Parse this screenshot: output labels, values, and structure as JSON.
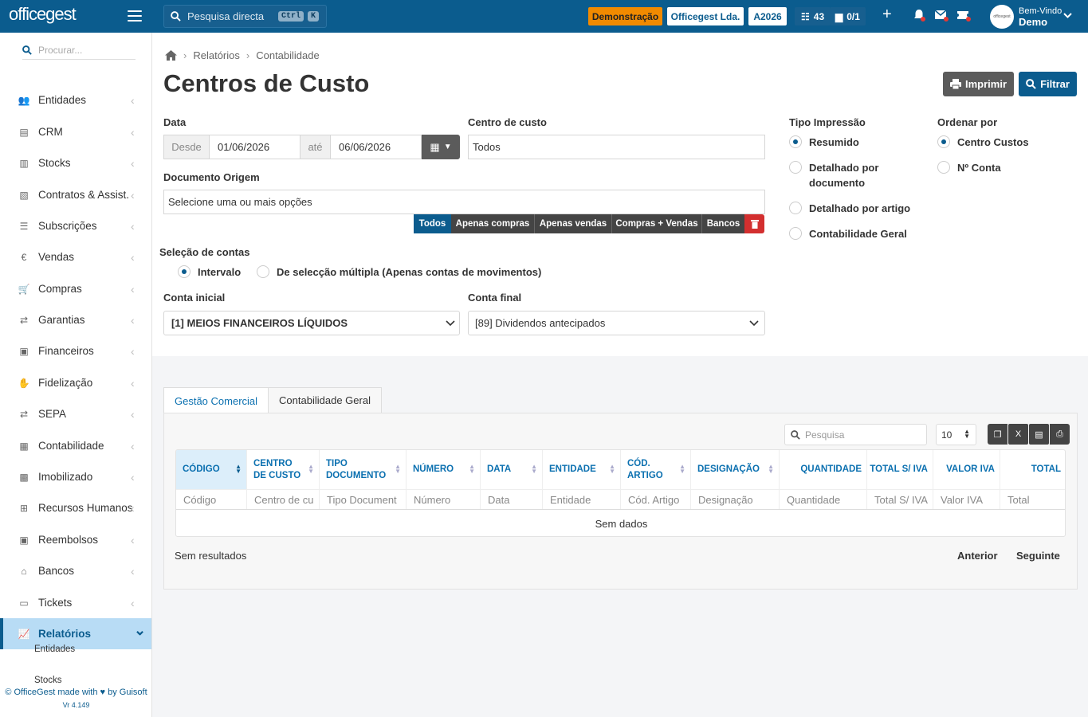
{
  "topbar": {
    "logo": "officegest",
    "search_placeholder": "Pesquisa directa",
    "kbd1": "Ctrl",
    "kbd2": "K",
    "badge_demo": "Demonstração",
    "badge_company": "Officegest Lda.",
    "badge_year": "A2026",
    "tasks_count": "43",
    "docs_count": "0/1",
    "welcome": "Bem-Vindo",
    "user": "Demo",
    "colors": {
      "bar": "#0b5c8e",
      "demo": "#f18a00"
    }
  },
  "sidebar": {
    "search_placeholder": "Procurar...",
    "items": [
      {
        "label": "Entidades",
        "icon": "users-icon"
      },
      {
        "label": "CRM",
        "icon": "book-icon"
      },
      {
        "label": "Stocks",
        "icon": "warehouse-icon"
      },
      {
        "label": "Contratos & Assist.",
        "icon": "file-contract-icon"
      },
      {
        "label": "Subscrições",
        "icon": "list-icon"
      },
      {
        "label": "Vendas",
        "icon": "euro-icon"
      },
      {
        "label": "Compras",
        "icon": "cart-icon"
      },
      {
        "label": "Garantias",
        "icon": "exchange-icon"
      },
      {
        "label": "Financeiros",
        "icon": "money-icon"
      },
      {
        "label": "Fidelização",
        "icon": "hand-coin-icon"
      },
      {
        "label": "SEPA",
        "icon": "exchange-icon"
      },
      {
        "label": "Contabilidade",
        "icon": "calculator-icon"
      },
      {
        "label": "Imobilizado",
        "icon": "box-icon"
      },
      {
        "label": "Recursos Humanos",
        "icon": "sitemap-icon"
      },
      {
        "label": "Reembolsos",
        "icon": "money-icon"
      },
      {
        "label": "Bancos",
        "icon": "bank-icon"
      },
      {
        "label": "Tickets",
        "icon": "ticket-icon"
      },
      {
        "label": "Relatórios",
        "icon": "chart-icon"
      }
    ],
    "sub_items": [
      "Entidades",
      "Stocks"
    ],
    "footer_line1": "© OfficeGest made with",
    "footer_line1b": "by Guisoft",
    "version": "Vr 4.149"
  },
  "page": {
    "breadcrumb": [
      "Relatórios",
      "Contabilidade"
    ],
    "title": "Centros de Custo",
    "print_btn": "Imprimir",
    "filter_btn": "Filtrar"
  },
  "form": {
    "data_label": "Data",
    "desde": "Desde",
    "date_from": "01/06/2026",
    "ate": "até",
    "date_to": "06/06/2026",
    "centro_label": "Centro de custo",
    "centro_value": "Todos",
    "doc_label": "Documento Origem",
    "doc_placeholder": "Selecione uma ou mais opções",
    "doc_buttons": [
      "Todos",
      "Apenas compras",
      "Apenas vendas",
      "Compras + Vendas",
      "Bancos"
    ],
    "tipo_label": "Tipo Impressão",
    "tipo_options": [
      "Resumido",
      "Detalhado por documento",
      "Detalhado por artigo",
      "Contabilidade Geral"
    ],
    "ordenar_label": "Ordenar por",
    "ordenar_options": [
      "Centro Custos",
      "Nº Conta"
    ],
    "selecao_label": "Seleção de contas",
    "selecao_options": [
      "Intervalo",
      "De selecção múltipla (Apenas contas de movimentos)"
    ],
    "conta_inicial_label": "Conta inicial",
    "conta_inicial_value": "[1] MEIOS FINANCEIROS LÍQUIDOS",
    "conta_final_label": "Conta final",
    "conta_final_value": "[89] Dividendos antecipados"
  },
  "results": {
    "tabs": [
      "Gestão Comercial",
      "Contabilidade Geral"
    ],
    "search_placeholder": "Pesquisa",
    "page_size": "10",
    "columns": [
      {
        "header": "CÓDIGO",
        "filter": "Código"
      },
      {
        "header": "CENTRO DE CUSTO",
        "filter": "Centro de cu"
      },
      {
        "header": "TIPO DOCUMENTO",
        "filter": "Tipo Document"
      },
      {
        "header": "NÚMERO",
        "filter": "Número"
      },
      {
        "header": "DATA",
        "filter": "Data"
      },
      {
        "header": "ENTIDADE",
        "filter": "Entidade"
      },
      {
        "header": "CÓD. ARTIGO",
        "filter": "Cód. Artigo"
      },
      {
        "header": "DESIGNAÇÃO",
        "filter": "Designação"
      },
      {
        "header": "QUANTIDADE",
        "filter": "Quantidade"
      },
      {
        "header": "TOTAL S/ IVA",
        "filter": "Total S/ IVA"
      },
      {
        "header": "VALOR IVA",
        "filter": "Valor IVA"
      },
      {
        "header": "TOTAL",
        "filter": "Total"
      }
    ],
    "no_data": "Sem dados",
    "no_results": "Sem resultados",
    "prev": "Anterior",
    "next": "Seguinte"
  }
}
